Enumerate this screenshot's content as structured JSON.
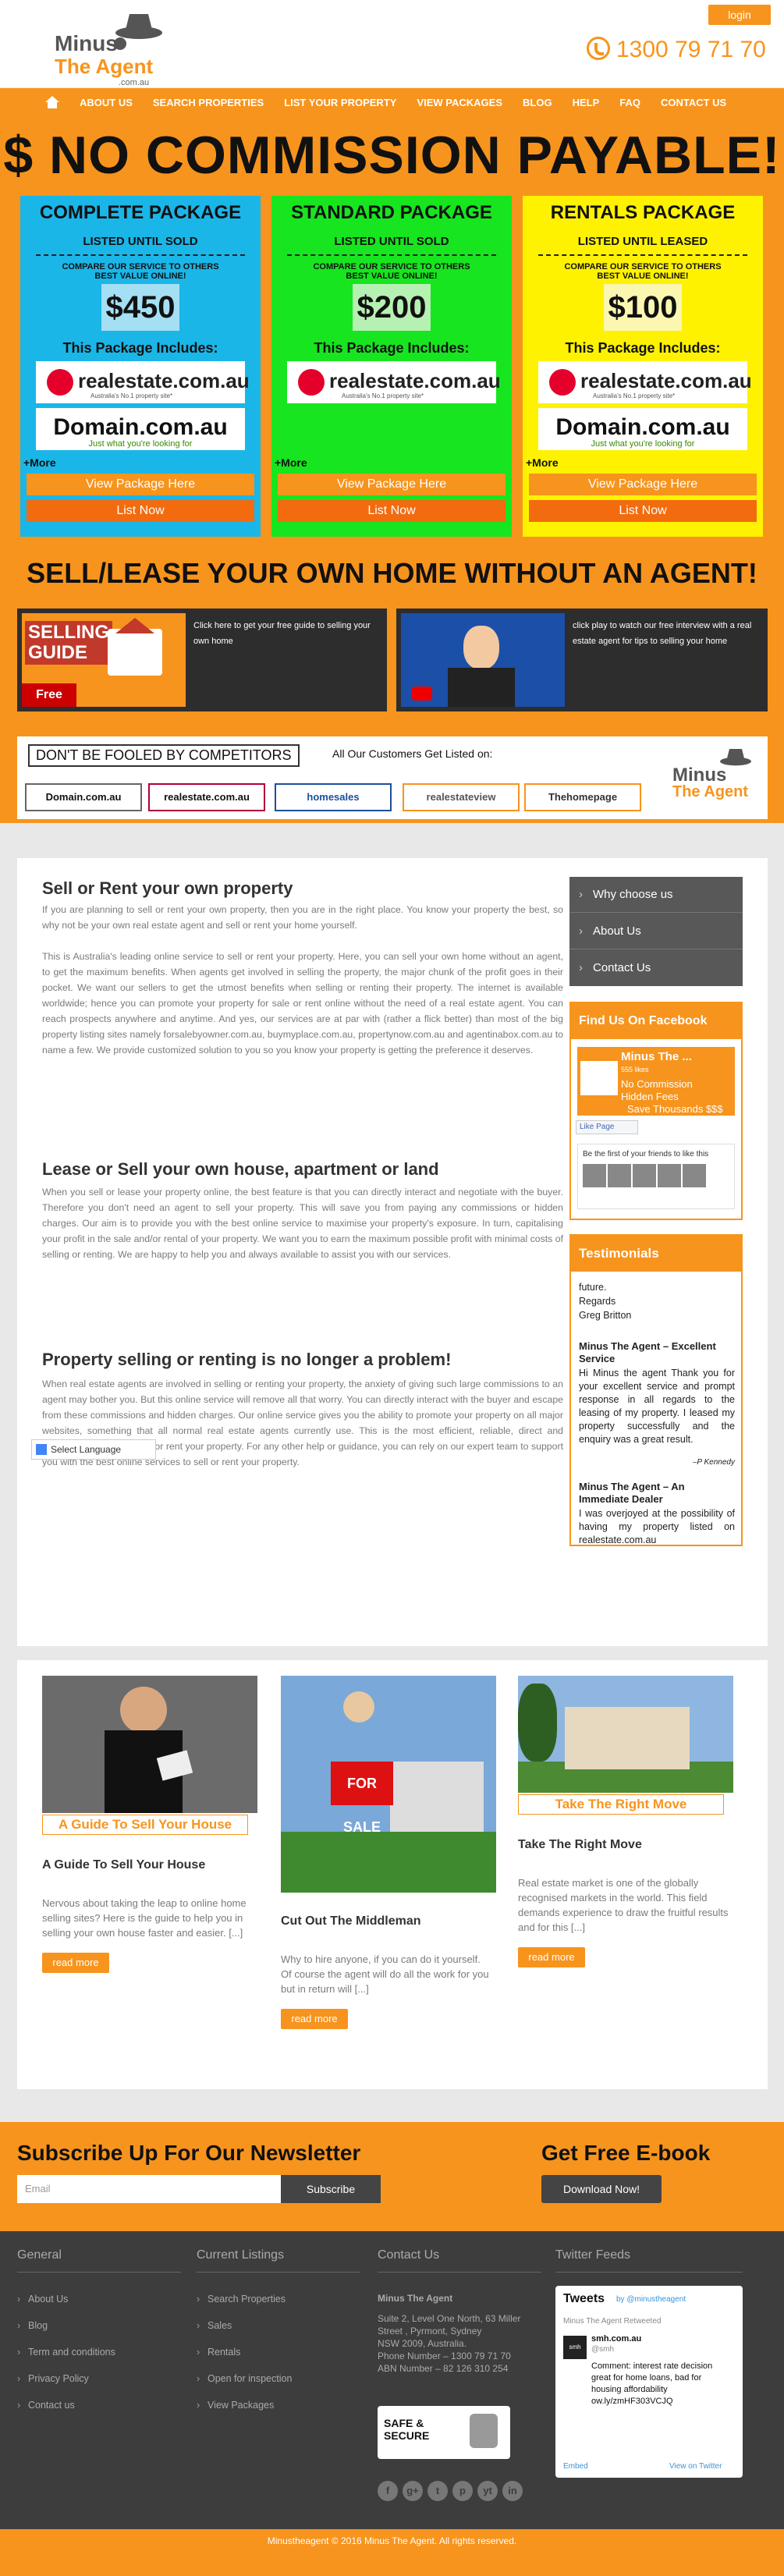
{
  "header": {
    "logo": {
      "line1": "Minus",
      "line2": "The Agent",
      "line3": ".com.au"
    },
    "login": "login",
    "phone": "1300 79 71 70"
  },
  "nav": [
    "ABOUT US",
    "SEARCH PROPERTIES",
    "LIST YOUR PROPERTY",
    "VIEW PACKAGES",
    "BLOG",
    "HELP",
    "FAQ",
    "CONTACT US"
  ],
  "promo": {
    "headline": "$ NO COMMISSION PAYABLE!",
    "packages": [
      {
        "title": "COMPLETE PACKAGE",
        "sub": "LISTED UNTIL SOLD",
        "compare1": "COMPARE OUR SERVICE TO OTHERS",
        "compare2": "BEST VALUE ONLINE!",
        "price": "$450",
        "includes": "This Package Includes:",
        "more": "+More",
        "btn1": "View Package Here",
        "btn2": "List Now",
        "bg": "#1ab6e8",
        "price_bg": "#a5dff4"
      },
      {
        "title": "STANDARD PACKAGE",
        "sub": "LISTED UNTIL SOLD",
        "compare1": "COMPARE OUR SERVICE TO OTHERS",
        "compare2": "BEST VALUE ONLINE!",
        "price": "$200",
        "includes": "This Package Includes:",
        "more": "+More",
        "btn1": "View Package Here",
        "btn2": "List Now",
        "bg": "#17e51f",
        "price_bg": "#b6f0b2"
      },
      {
        "title": "RENTALS PACKAGE",
        "sub": "LISTED UNTIL LEASED",
        "compare1": "COMPARE OUR SERVICE TO OTHERS",
        "compare2": "BEST VALUE ONLINE!",
        "price": "$100",
        "includes": "This Package Includes:",
        "more": "+More",
        "btn1": "View Package Here",
        "btn2": "List Now",
        "bg": "#fef200",
        "price_bg": "#fbf7b0"
      }
    ],
    "rea": "realestate.com.au",
    "rea_sub": "Australia's No.1 property site*",
    "domain": "Domain.com.au",
    "domain_sub": "Just what you're looking for",
    "sell_headline": "SELL/LEASE YOUR OWN HOME WITHOUT AN AGENT!",
    "guide": {
      "img1": "SELLING",
      "img2": "GUIDE",
      "free": "Free",
      "text": "Click here to get your free guide to selling your own home"
    },
    "video": {
      "text": "click play to watch our free interview with a real estate agent for tips to selling your home"
    },
    "fooled": {
      "title": "DON'T BE FOOLED BY COMPETITORS",
      "customers": "All Our Customers Get Listed on:",
      "brands": [
        "Domain.com.au",
        "realestate.com.au",
        "homesales",
        "realestateview",
        "Thehomepage"
      ]
    }
  },
  "content": {
    "sections": [
      {
        "heading": "Sell or Rent your own property",
        "paras": [
          "If you are planning to sell or rent your own property, then you are in the right place. You know your property the best, so why not be your own real estate agent and sell or rent your home yourself.",
          "This is Australia's leading online service to sell or rent your property. Here, you can sell your own home without an agent, to get the maximum benefits. When agents get involved in selling the property, the major chunk of the profit goes in their pocket. We want our sellers to get the utmost benefits when selling or renting their property. The internet is available worldwide; hence you can promote your property for sale or rent online without the need of a real estate agent. You can reach prospects anywhere and anytime. And yes, our services are at par with (rather a flick better) than most of the big property listing sites namely forsalebyowner.com.au, buymyplace.com.au, propertynow.com.au and agentinabox.com.au to name a few. We provide customized solution to you so you know your property is getting the preference it deserves."
        ]
      },
      {
        "heading": "Lease or Sell your own house, apartment or land",
        "paras": [
          "When you sell or lease your property online, the best feature is that you can directly interact and negotiate with the buyer. Therefore you don't need an agent to sell your property. This will save you from paying any commissions or hidden charges. Our aim is to provide you with the best online service to maximise your property's exposure. In turn, capitalising your profit in the sale and/or rental of your property. We want you to earn the maximum possible profit with minimal costs of selling or renting. We are happy to help you and always available to assist you with our services."
        ]
      },
      {
        "heading": "Property selling or renting is no longer a problem!",
        "paras": [
          "When real estate agents are involved in selling or renting your property, the anxiety of giving such large commissions to an agent may bother you. But this online service will remove all that worry. You can directly interact with the buyer and escape from these commissions and hidden charges. Our online service gives you the ability to promote your property on all major websites, something that all normal real estate agents currently use. This is the most efficient, reliable, direct and reasonable method to sell or rent your property. For any other help or guidance, you can rely on our expert team to support you with the best online services to sell or rent your property."
        ]
      }
    ],
    "language": "Select Language"
  },
  "sidebar": {
    "menu": [
      "Why choose us",
      "About Us",
      "Contact Us"
    ],
    "facebook": {
      "heading": "Find Us On Facebook",
      "name": "Minus The ...",
      "likes": "555 likes",
      "s1": "No Commission",
      "s2": "Hidden Fees",
      "s3": "Save Thousands $$$",
      "like": "Like Page",
      "first": "Be the first of your friends to like this"
    },
    "testimonials": {
      "heading": "Testimonials",
      "t1_text": "future.",
      "t1_regards": "Regards",
      "t1_name": "Greg Britton",
      "t2_title": "Minus The Agent – Excellent Service",
      "t2_text": "Hi Minus the agent Thank you for your excellent service and prompt response in all regards to the leasing of my property. I leased my property successfully and the enquiry was a great result.",
      "t2_author": "–P Kennedy",
      "t3_title": "Minus The Agent – An Immediate Dealer",
      "t3_text": "I was overjoyed at the possibility of having my property listed on realestate.com.au"
    }
  },
  "blogs": [
    {
      "caption": "A Guide To Sell Your House",
      "title": "A Guide To Sell Your House",
      "desc": "Nervous about taking the leap to online home selling sites? Here is the guide to help you in selling your own house faster and easier. [...]",
      "more": "read more"
    },
    {
      "caption": "",
      "title": "Cut Out The Middleman",
      "desc": "Why to hire anyone, if you can do it yourself. Of course the agent will do all the work for you but in return will [...]",
      "more": "read more",
      "sign": "FOR SALE"
    },
    {
      "caption": "Take The Right Move",
      "title": "Take The Right Move",
      "desc": "Real estate market is one of the globally recognised markets in the world. This field demands experience to draw the fruitful results and for this [...]",
      "more": "read more"
    }
  ],
  "newsletter": {
    "heading": "Subscribe Up For Our Newsletter",
    "placeholder": "Email",
    "subscribe": "Subscribe",
    "ebook": "Get Free E-book",
    "download": "Download Now!"
  },
  "footer": {
    "general": {
      "heading": "General",
      "items": [
        "About Us",
        "Blog",
        "Term and conditions",
        "Privacy Policy",
        "Contact us"
      ]
    },
    "listings": {
      "heading": "Current Listings",
      "items": [
        "Search Properties",
        "Sales",
        "Rentals",
        "Open for inspection",
        "View Packages"
      ]
    },
    "contact": {
      "heading": "Contact Us",
      "name": "Minus The Agent",
      "lines": [
        "Suite 2, Level One North, 63 Miller",
        "Street , Pyrmont, Sydney",
        "NSW 2009, Australia.",
        "Phone Number – 1300 79 71 70",
        "ABN Number – 82 126 310 254"
      ],
      "safe": "SAFE & SECURE"
    },
    "twitter": {
      "heading": "Twitter Feeds",
      "title": "Tweets",
      "by": "by @minustheagent",
      "retweet": "Minus The Agent Retweeted",
      "user": "smh.com.au",
      "handle": "@smh",
      "avatar": "smh",
      "text": "Comment: interest rate decision great for home loans, bad for housing affordability ow.ly/zmHF303VCJQ",
      "embed": "Embed",
      "view": "View on Twitter"
    },
    "social": [
      "f",
      "g+",
      "t",
      "p",
      "yt",
      "in"
    ],
    "copyright": "Minustheagent © 2016 Minus The Agent. All rights reserved."
  }
}
